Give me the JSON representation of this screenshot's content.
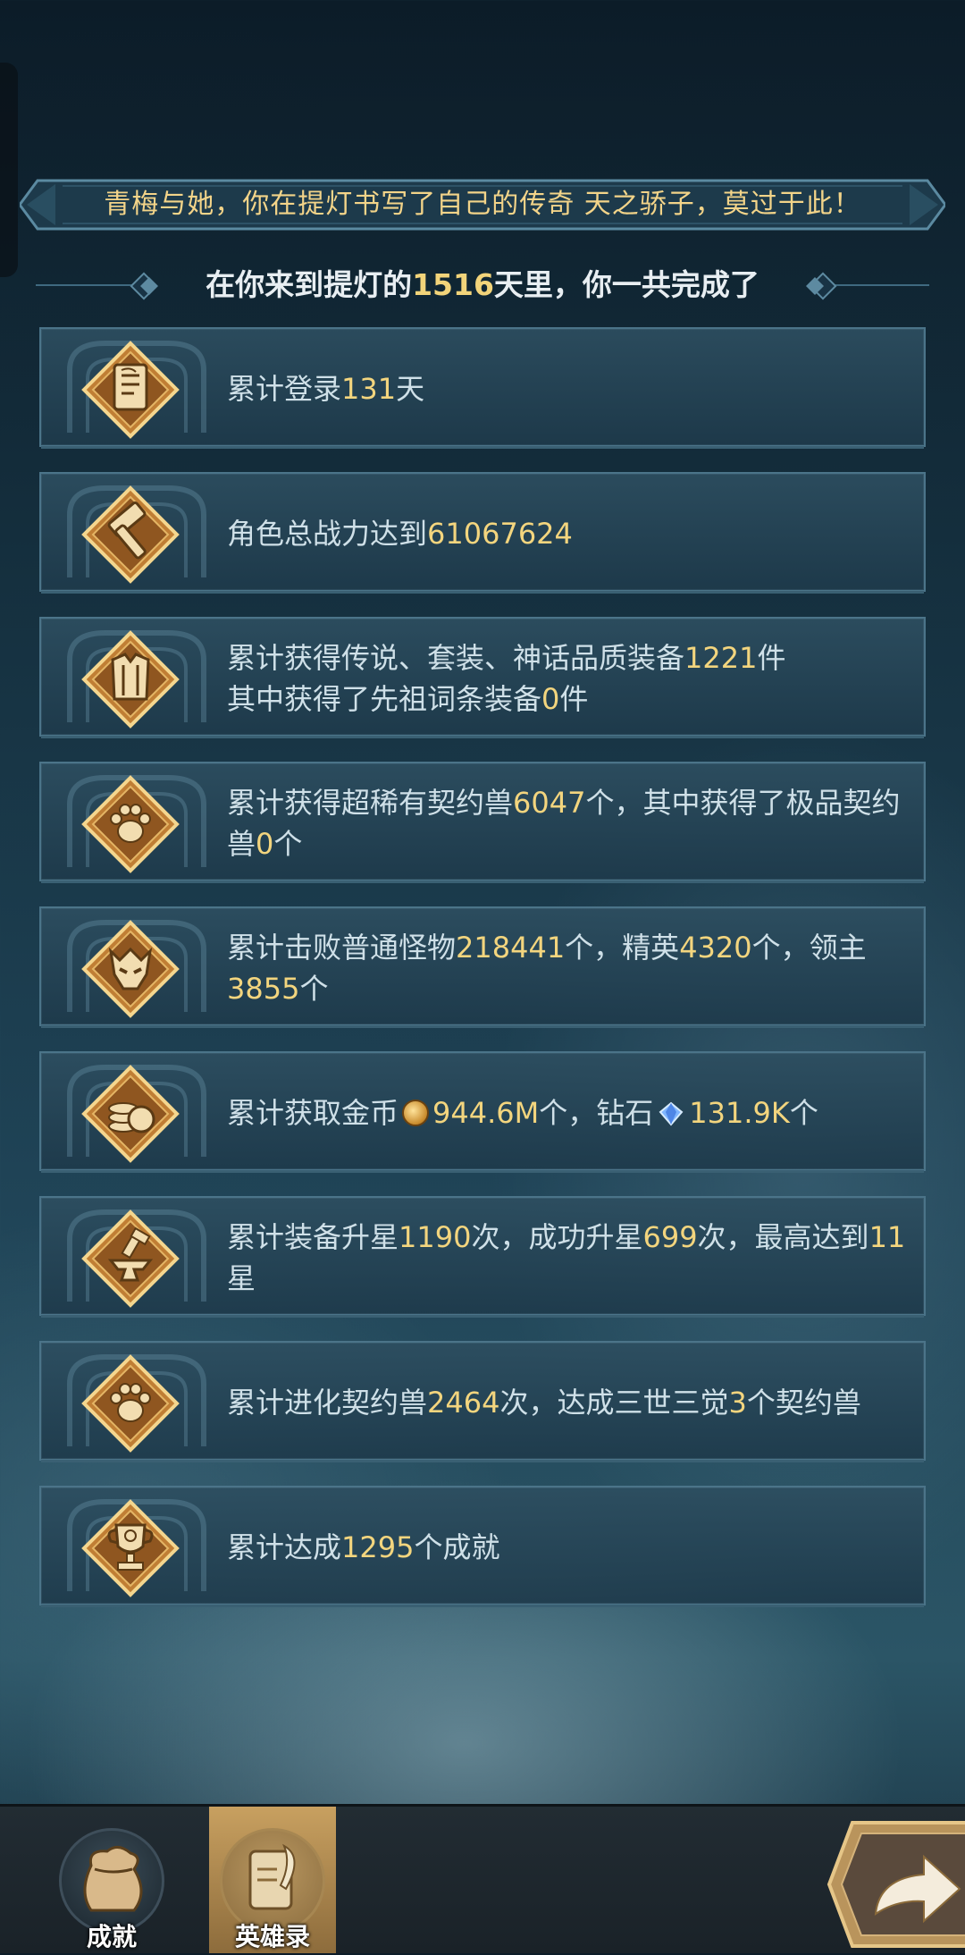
{
  "banner": {
    "text": "青梅与她，你在提灯书写了自己的传奇 天之骄子，莫过于此！"
  },
  "subtitle": {
    "prefix": "在你来到提灯的",
    "days": "1516",
    "suffix": "天里，你一共完成了"
  },
  "records": [
    {
      "icon": "scroll-icon",
      "parts": [
        [
          "t",
          "累计登录"
        ],
        [
          "n",
          "131"
        ],
        [
          "t",
          "天"
        ]
      ]
    },
    {
      "icon": "hammer-icon",
      "parts": [
        [
          "t",
          "角色总战力达到"
        ],
        [
          "n",
          "61067624"
        ]
      ]
    },
    {
      "icon": "armor-icon",
      "parts": [
        [
          "t",
          "累计获得传说、套装、神话品质装备"
        ],
        [
          "n",
          "1221"
        ],
        [
          "t",
          "件"
        ],
        [
          "br",
          ""
        ],
        [
          "t",
          "其中获得了先祖词条装备"
        ],
        [
          "n",
          "0"
        ],
        [
          "t",
          "件"
        ]
      ]
    },
    {
      "icon": "paw-icon",
      "parts": [
        [
          "t",
          "累计获得超稀有契约兽"
        ],
        [
          "n",
          "6047"
        ],
        [
          "t",
          "个，其中获得了极品契约兽"
        ],
        [
          "n",
          "0"
        ],
        [
          "t",
          "个"
        ]
      ]
    },
    {
      "icon": "demon-mask-icon",
      "parts": [
        [
          "t",
          "累计击败普通怪物"
        ],
        [
          "n",
          "218441"
        ],
        [
          "t",
          "个，精英"
        ],
        [
          "n",
          "4320"
        ],
        [
          "t",
          "个，领主"
        ],
        [
          "n",
          "3855"
        ],
        [
          "t",
          "个"
        ]
      ]
    },
    {
      "icon": "coins-icon",
      "parts": [
        [
          "t",
          "累计获取金币"
        ],
        [
          "coin",
          ""
        ],
        [
          "n",
          "944.6M"
        ],
        [
          "t",
          "个，钻石"
        ],
        [
          "gem",
          ""
        ],
        [
          "n",
          "131.9K"
        ],
        [
          "t",
          "个"
        ]
      ]
    },
    {
      "icon": "anvil-icon",
      "parts": [
        [
          "t",
          "累计装备升星"
        ],
        [
          "n",
          "1190"
        ],
        [
          "t",
          "次，成功升星"
        ],
        [
          "n",
          "699"
        ],
        [
          "t",
          "次，最高达到"
        ],
        [
          "n",
          "11"
        ],
        [
          "t",
          "星"
        ]
      ]
    },
    {
      "icon": "paw-icon",
      "parts": [
        [
          "t",
          "累计进化契约兽"
        ],
        [
          "n",
          "2464"
        ],
        [
          "t",
          "次，达成三世三觉"
        ],
        [
          "n",
          "3"
        ],
        [
          "t",
          "个契约兽"
        ]
      ]
    },
    {
      "icon": "trophy-icon",
      "parts": [
        [
          "t",
          "累计达成"
        ],
        [
          "n",
          "1295"
        ],
        [
          "t",
          "个成就"
        ]
      ]
    }
  ],
  "nav": {
    "achievements_label": "成就",
    "hero_records_label": "英雄录"
  },
  "colors": {
    "gold": "#f3d57e",
    "card_bg": "#2d4e60",
    "banner_text": "#f3d489"
  }
}
